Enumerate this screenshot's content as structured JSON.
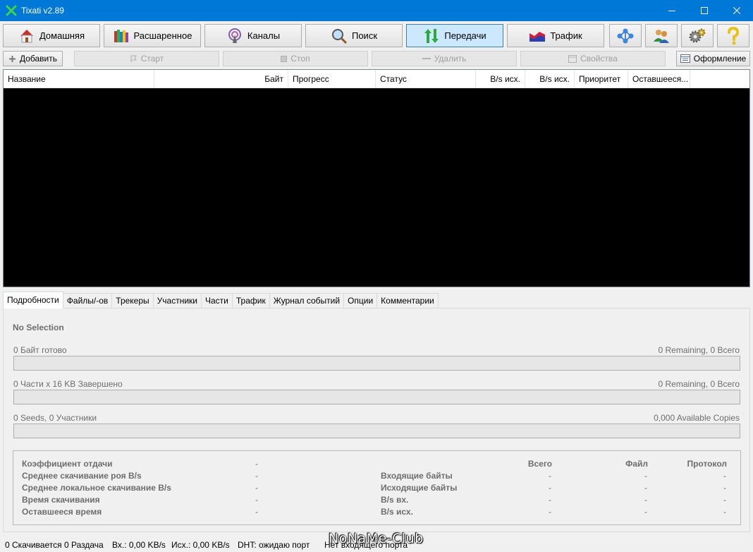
{
  "window": {
    "title": "Tixati v2.89"
  },
  "nav": {
    "home": "Домашняя",
    "shared": "Расшаренное",
    "channels": "Каналы",
    "search": "Поиск",
    "transfers": "Передачи",
    "traffic": "Трафик"
  },
  "actions": {
    "add": "Добавить",
    "start": "Старт",
    "stop": "Стоп",
    "remove": "Удалить",
    "properties": "Свойства",
    "layout": "Оформление"
  },
  "columns": [
    "Название",
    "Байт",
    "Прогресс",
    "Статус",
    "B/s исх.",
    "B/s исх.",
    "Приоритет",
    "Оставшееся..."
  ],
  "tabs": [
    "Подробности",
    "Файлы/-ов",
    "Трекеры",
    "Участники",
    "Части",
    "Трафик",
    "Журнал событий",
    "Опции",
    "Комментарии"
  ],
  "details": {
    "no_selection": "No Selection",
    "bytes_ready": "0 Байт готово",
    "bytes_remaining": "0 Remaining,  0 Всего",
    "bytes_progress": 0,
    "pieces_done": "0 Части  x  16 KB Завершено",
    "pieces_remaining": "0 Remaining,  0 Всего",
    "pieces_progress": 0,
    "seeds_peers": "0 Seeds, 0 Участники",
    "copies": "0,000 Available Copies",
    "copies_progress": 0
  },
  "stats": {
    "left_labels": [
      "Коэффициент отдачи",
      "Среднее скачивание роя B/s",
      "Среднее локальное скачивание B/s",
      "Время скачивания",
      "Оставшееся время"
    ],
    "left_values": [
      "-",
      "-",
      "-",
      "-",
      "-"
    ],
    "headers": [
      "Всего",
      "Файл",
      "Протокол"
    ],
    "right_labels": [
      "Входящие байты",
      "Исходящие байты",
      "B/s вх.",
      "B/s исх."
    ],
    "total": [
      "-",
      "-",
      "-",
      "-"
    ],
    "file": [
      "-",
      "-",
      "-",
      "-"
    ],
    "protocol": [
      "-",
      "-",
      "-",
      "-"
    ]
  },
  "status": {
    "downloading": "0 Скачивается",
    "seeding": "0 Раздача",
    "in": "Вх.: 0,00 KB/s",
    "out": "Исх.: 0,00 KB/s",
    "dht": "DHT: ожидаю порт",
    "port": "Нет входящего порта"
  },
  "watermark": "NoNaMe-Club",
  "colors": {
    "titlebar": "#0078d7",
    "active_tab": "#cce8ff",
    "list_bg": "#000000"
  }
}
